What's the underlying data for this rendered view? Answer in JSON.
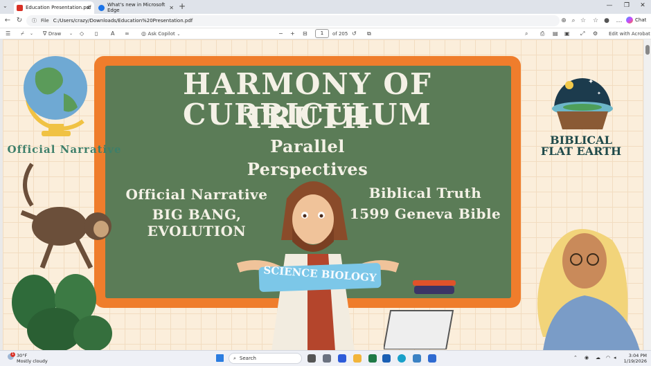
{
  "tabs": [
    {
      "title": "Education Presentation.pdf",
      "active": true,
      "favicon_color": "#d93025"
    },
    {
      "title": "What's new in Microsoft Edge",
      "active": false,
      "favicon_color": "#1a73e8"
    }
  ],
  "address_bar": {
    "scheme_label": "File",
    "url": "C:/Users/crazy/Downloads/Education%20Presentation.pdf"
  },
  "browser": {
    "chat_label": "Chat"
  },
  "pdf_toolbar": {
    "draw_label": "Draw",
    "copilot_label": "Ask Copilot",
    "page_current": "1",
    "page_total": "of 205",
    "edit_acrobat_label": "Edit with Acrobat"
  },
  "slide": {
    "title_line1": "HARMONY OF TRUTH",
    "title_line2": "CURRICULUM",
    "subtitle_line1": "Parallel",
    "subtitle_line2": "Perspectives",
    "left_heading": "Official Narrative",
    "left_detail": "BIG BANG, EVOLUTION",
    "right_heading": "Biblical Truth",
    "right_detail": "1599 Geneva Bible",
    "banner_text": "SCIENCE BIOLOGY",
    "side_left_label": "Official Narrative",
    "side_right_line1": "BIBLICAL",
    "side_right_line2": "FLAT EARTH",
    "colors": {
      "board": "#5b7c57",
      "frame": "#ef7d2c",
      "chalk": "#f4f1e6"
    }
  },
  "taskbar": {
    "weather_temp": "30°F",
    "weather_desc": "Mostly cloudy",
    "weather_badge": "1",
    "search_placeholder": "Search",
    "time": "3:04 PM",
    "date": "1/19/2026"
  }
}
